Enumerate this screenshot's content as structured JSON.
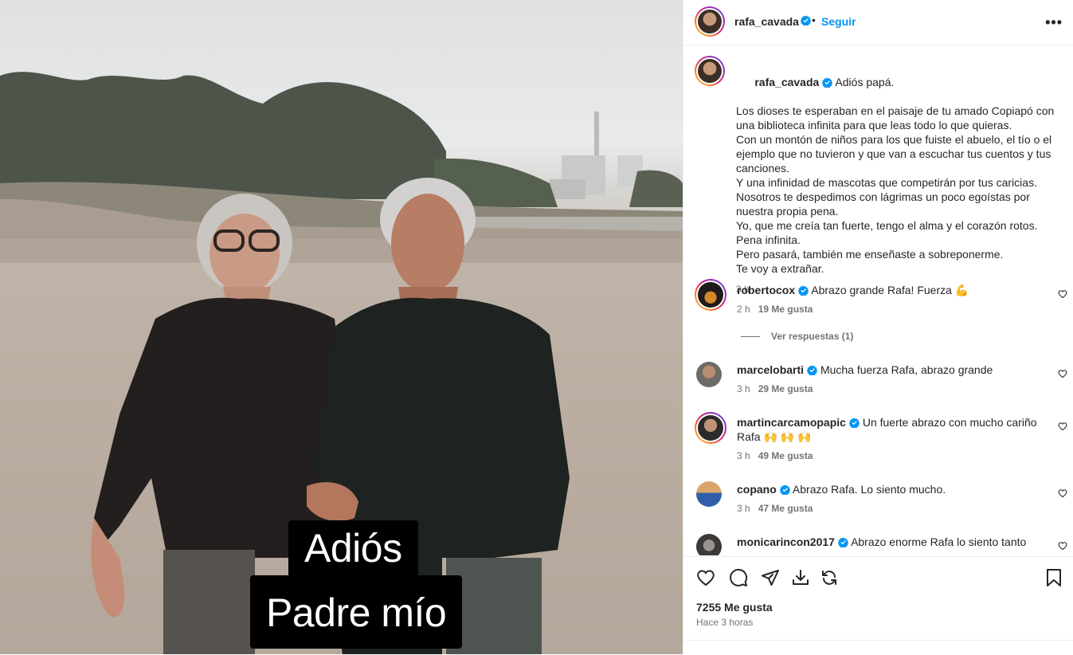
{
  "post": {
    "author": "rafa_cavada",
    "follow_label": "Seguir",
    "menu_label": "•••",
    "overlay_line1": "Adiós",
    "overlay_line2": "Padre mío",
    "caption_lines": [
      "Adiós papá.",
      "Los dioses te esperaban en el paisaje de tu amado Copiapó con una biblioteca infinita para que leas todo lo que quieras.",
      "Con un montón de niños para los que fuiste el abuelo, el tío o el ejemplo que no tuvieron y que van a escuchar tus cuentos y tus canciones.",
      "Y una infinidad de mascotas que competirán por tus caricias.",
      "Nosotros te despedimos con lágrimas un poco egoístas por nuestra propia pena.",
      "Yo, que me creía tan fuerte, tengo el alma y el corazón rotos.",
      "Pena infinita.",
      "Pero pasará, también me enseñaste a sobreponerme.",
      "Te voy a extrañar."
    ],
    "caption_time": "3 h",
    "likes": "7255 Me gusta",
    "posted_ago": "Hace 3 horas"
  },
  "comments": [
    {
      "user": "robertocox",
      "text": "Abrazo grande Rafa! Fuerza 💪",
      "time": "2 h",
      "likes": "19 Me gusta"
    },
    {
      "user": "marcelobarti",
      "text": "Mucha fuerza Rafa, abrazo grande",
      "time": "3 h",
      "likes": "29 Me gusta"
    },
    {
      "user": "martincarcamopapic",
      "text": "Un fuerte abrazo con mucho cariño Rafa 🙌 🙌 🙌",
      "time": "3 h",
      "likes": "49 Me gusta"
    },
    {
      "user": "copano",
      "text": "Abrazo Rafa. Lo siento mucho.",
      "time": "3 h",
      "likes": "47 Me gusta"
    },
    {
      "user": "monicarincon2017",
      "text": "Abrazo enorme Rafa lo siento tanto",
      "time": "",
      "likes": ""
    }
  ],
  "view_replies": "Ver respuestas (1)",
  "icons": {
    "verified": "verified-badge-icon",
    "like": "heart-icon",
    "comment": "comment-icon",
    "share": "send-icon",
    "repost_download": "download-icon",
    "repost": "repost-icon",
    "save": "bookmark-icon",
    "more": "more-options-icon"
  },
  "colors": {
    "accent": "#0095f6",
    "verified": "#0095f6",
    "text": "#262626",
    "muted": "#737373",
    "divider": "#efefef"
  }
}
